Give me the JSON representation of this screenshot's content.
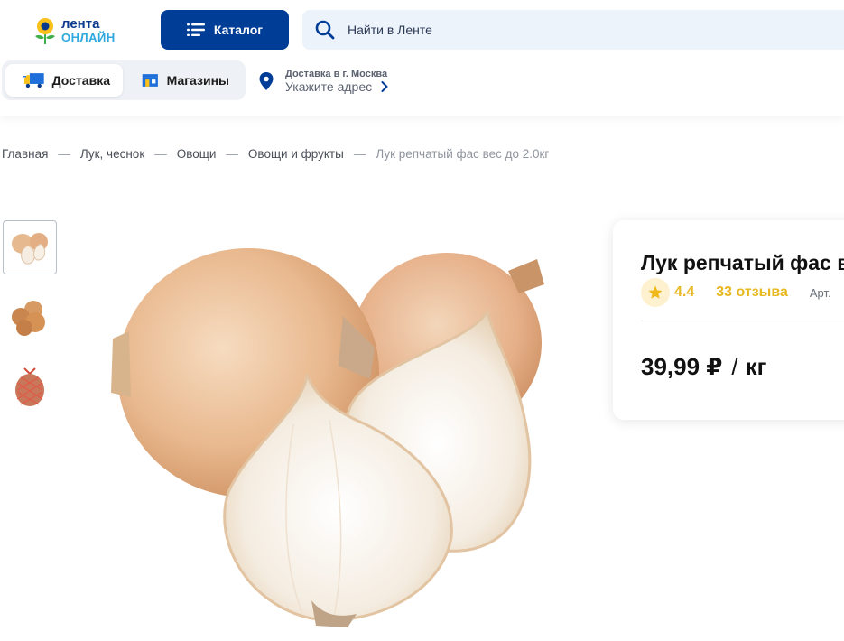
{
  "header": {
    "logo": {
      "line1": "лента",
      "line2": "ОНЛАЙН"
    },
    "catalog_label": "Каталог",
    "search_placeholder": "Найти в Ленте",
    "modes": [
      {
        "label": "Доставка",
        "active": true
      },
      {
        "label": "Магазины",
        "active": false
      }
    ],
    "delivery": {
      "city_line": "Доставка в г. Москва",
      "address_prompt": "Укажите адрес"
    }
  },
  "breadcrumbs": [
    "Главная",
    "Лук, чеснок",
    "Овощи",
    "Овощи и фрукты",
    "Лук репчатый фас вес до 2.0кг"
  ],
  "breadcrumb_separator": "—",
  "gallery": {
    "thumbnails": [
      "onion-halves",
      "onion-bunch",
      "onion-net-bag"
    ],
    "active_index": 0
  },
  "product": {
    "title_visible": "Лук репчатый фас в",
    "rating": "4.4",
    "reviews": "33 отзыва",
    "article_label": "Арт.",
    "price": "39,99 ₽",
    "price_separator": "/",
    "unit": "кг"
  },
  "colors": {
    "brand_blue": "#003d96",
    "search_bg": "#edf3fb",
    "rating_yellow": "#e8b820",
    "logo_light_blue": "#2fa8e0"
  }
}
